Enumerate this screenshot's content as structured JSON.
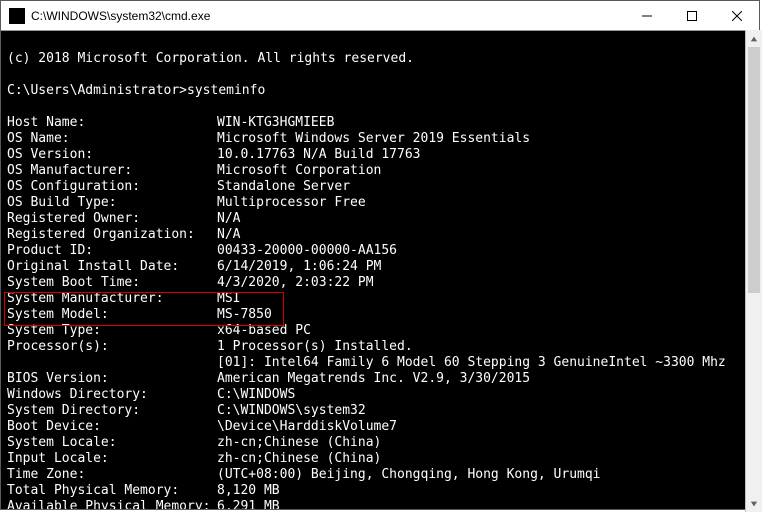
{
  "window": {
    "title": "C:\\WINDOWS\\system32\\cmd.exe"
  },
  "terminal": {
    "copyright": "(c) 2018 Microsoft Corporation. All rights reserved.",
    "prompt": "C:\\Users\\Administrator>",
    "command": "systeminfo",
    "rows": [
      {
        "label": "Host Name:",
        "value": "WIN-KTG3HGMIEEB"
      },
      {
        "label": "OS Name:",
        "value": "Microsoft Windows Server 2019 Essentials"
      },
      {
        "label": "OS Version:",
        "value": "10.0.17763 N/A Build 17763"
      },
      {
        "label": "OS Manufacturer:",
        "value": "Microsoft Corporation"
      },
      {
        "label": "OS Configuration:",
        "value": "Standalone Server"
      },
      {
        "label": "OS Build Type:",
        "value": "Multiprocessor Free"
      },
      {
        "label": "Registered Owner:",
        "value": "N/A"
      },
      {
        "label": "Registered Organization:",
        "value": "N/A"
      },
      {
        "label": "Product ID:",
        "value": "00433-20000-00000-AA156"
      },
      {
        "label": "Original Install Date:",
        "value": "6/14/2019, 1:06:24 PM"
      },
      {
        "label": "System Boot Time:",
        "value": "4/3/2020, 2:03:22 PM"
      },
      {
        "label": "System Manufacturer:",
        "value": "MSI"
      },
      {
        "label": "System Model:",
        "value": "MS-7850"
      },
      {
        "label": "System Type:",
        "value": "x64-based PC"
      },
      {
        "label": "Processor(s):",
        "value": "1 Processor(s) Installed."
      },
      {
        "label": "",
        "value": "[01]: Intel64 Family 6 Model 60 Stepping 3 GenuineIntel ~3300 Mhz"
      },
      {
        "label": "",
        "value": ""
      },
      {
        "label": "BIOS Version:",
        "value": "American Megatrends Inc. V2.9, 3/30/2015"
      },
      {
        "label": "Windows Directory:",
        "value": "C:\\WINDOWS"
      },
      {
        "label": "System Directory:",
        "value": "C:\\WINDOWS\\system32"
      },
      {
        "label": "Boot Device:",
        "value": "\\Device\\HarddiskVolume7"
      },
      {
        "label": "System Locale:",
        "value": "zh-cn;Chinese (China)"
      },
      {
        "label": "Input Locale:",
        "value": "zh-cn;Chinese (China)"
      },
      {
        "label": "Time Zone:",
        "value": "(UTC+08:00) Beijing, Chongqing, Hong Kong, Urumqi"
      },
      {
        "label": "Total Physical Memory:",
        "value": "8,120 MB"
      },
      {
        "label": "Available Physical Memory:",
        "value": "6,291 MB"
      }
    ]
  }
}
